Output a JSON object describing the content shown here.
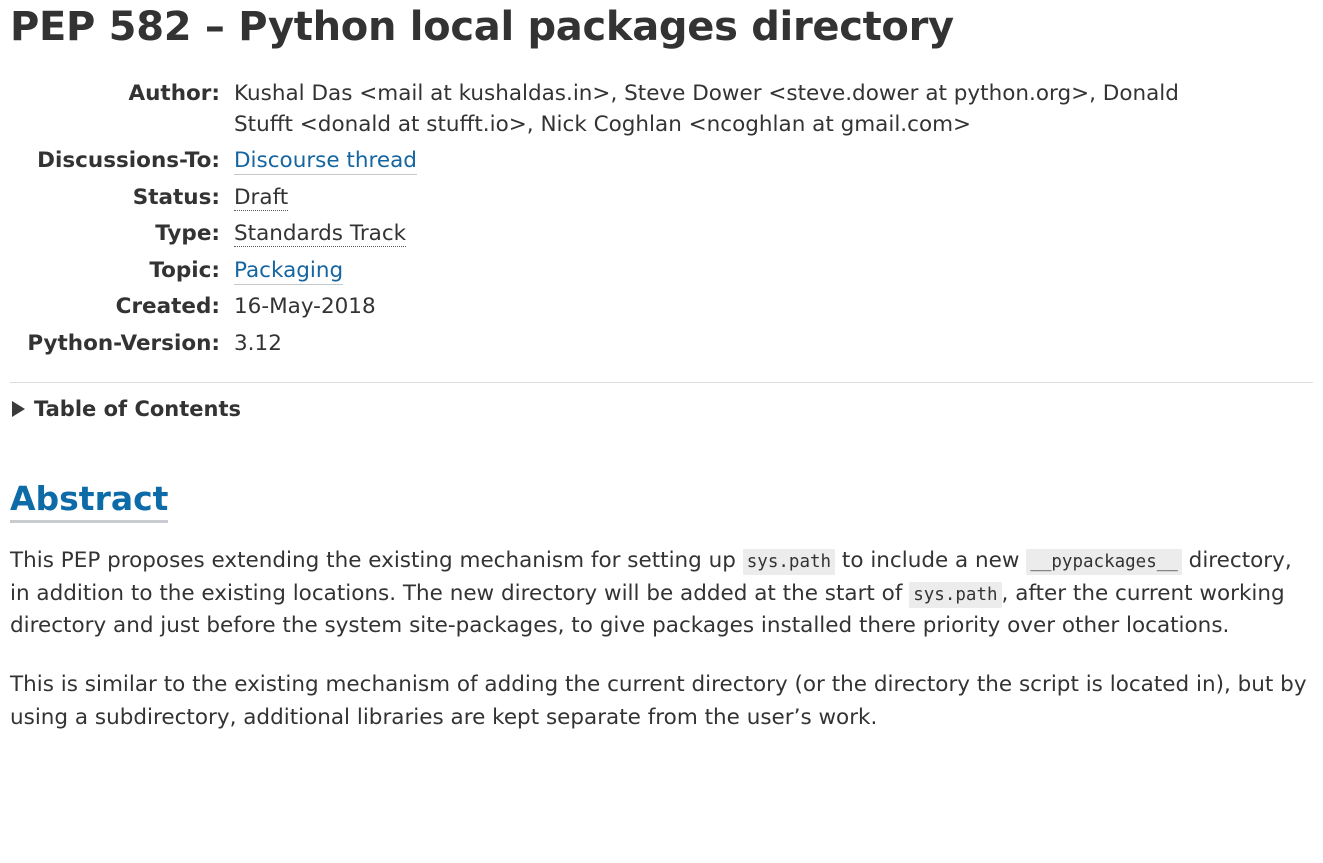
{
  "document": {
    "title": "PEP 582 – Python local packages directory"
  },
  "metadata": {
    "rows": [
      {
        "label": "Author:",
        "value": "Kushal Das <mail at kushaldas.in>, Steve Dower <steve.dower at python.org>, Donald Stufft <donald at stufft.io>, Nick Coghlan <ncoghlan at gmail.com>",
        "kind": "text"
      },
      {
        "label": "Discussions-To:",
        "value": "Discourse thread",
        "kind": "link"
      },
      {
        "label": "Status:",
        "value": "Draft",
        "kind": "abbr"
      },
      {
        "label": "Type:",
        "value": "Standards Track",
        "kind": "abbr"
      },
      {
        "label": "Topic:",
        "value": "Packaging",
        "kind": "link"
      },
      {
        "label": "Created:",
        "value": "16-May-2018",
        "kind": "text"
      },
      {
        "label": "Python-Version:",
        "value": "3.12",
        "kind": "text"
      }
    ]
  },
  "toc": {
    "label": "Table of Contents",
    "marker_icon": "triangle-right-icon",
    "expanded": false
  },
  "abstract": {
    "heading": "Abstract",
    "paragraph1": {
      "part1": "This PEP proposes extending the existing mechanism for setting up ",
      "code1": "sys.path",
      "part2": " to include a new ",
      "code2": "__pypackages__",
      "part3": " directory, in addition to the existing locations. The new directory will be added at the start of ",
      "code3": "sys.path",
      "part4": ", after the current working directory and just before the system site-packages, to give packages installed there priority over other locations."
    },
    "paragraph2": "This is similar to the existing mechanism of adding the current directory (or the directory the script is located in), but by using a subdirectory, additional libraries are kept separate from the user’s work."
  },
  "colors": {
    "link": "#1565a0",
    "heading_link": "#0d6ba8",
    "text": "#333333",
    "rule": "#dddddd",
    "code_bg": "#ececec"
  }
}
